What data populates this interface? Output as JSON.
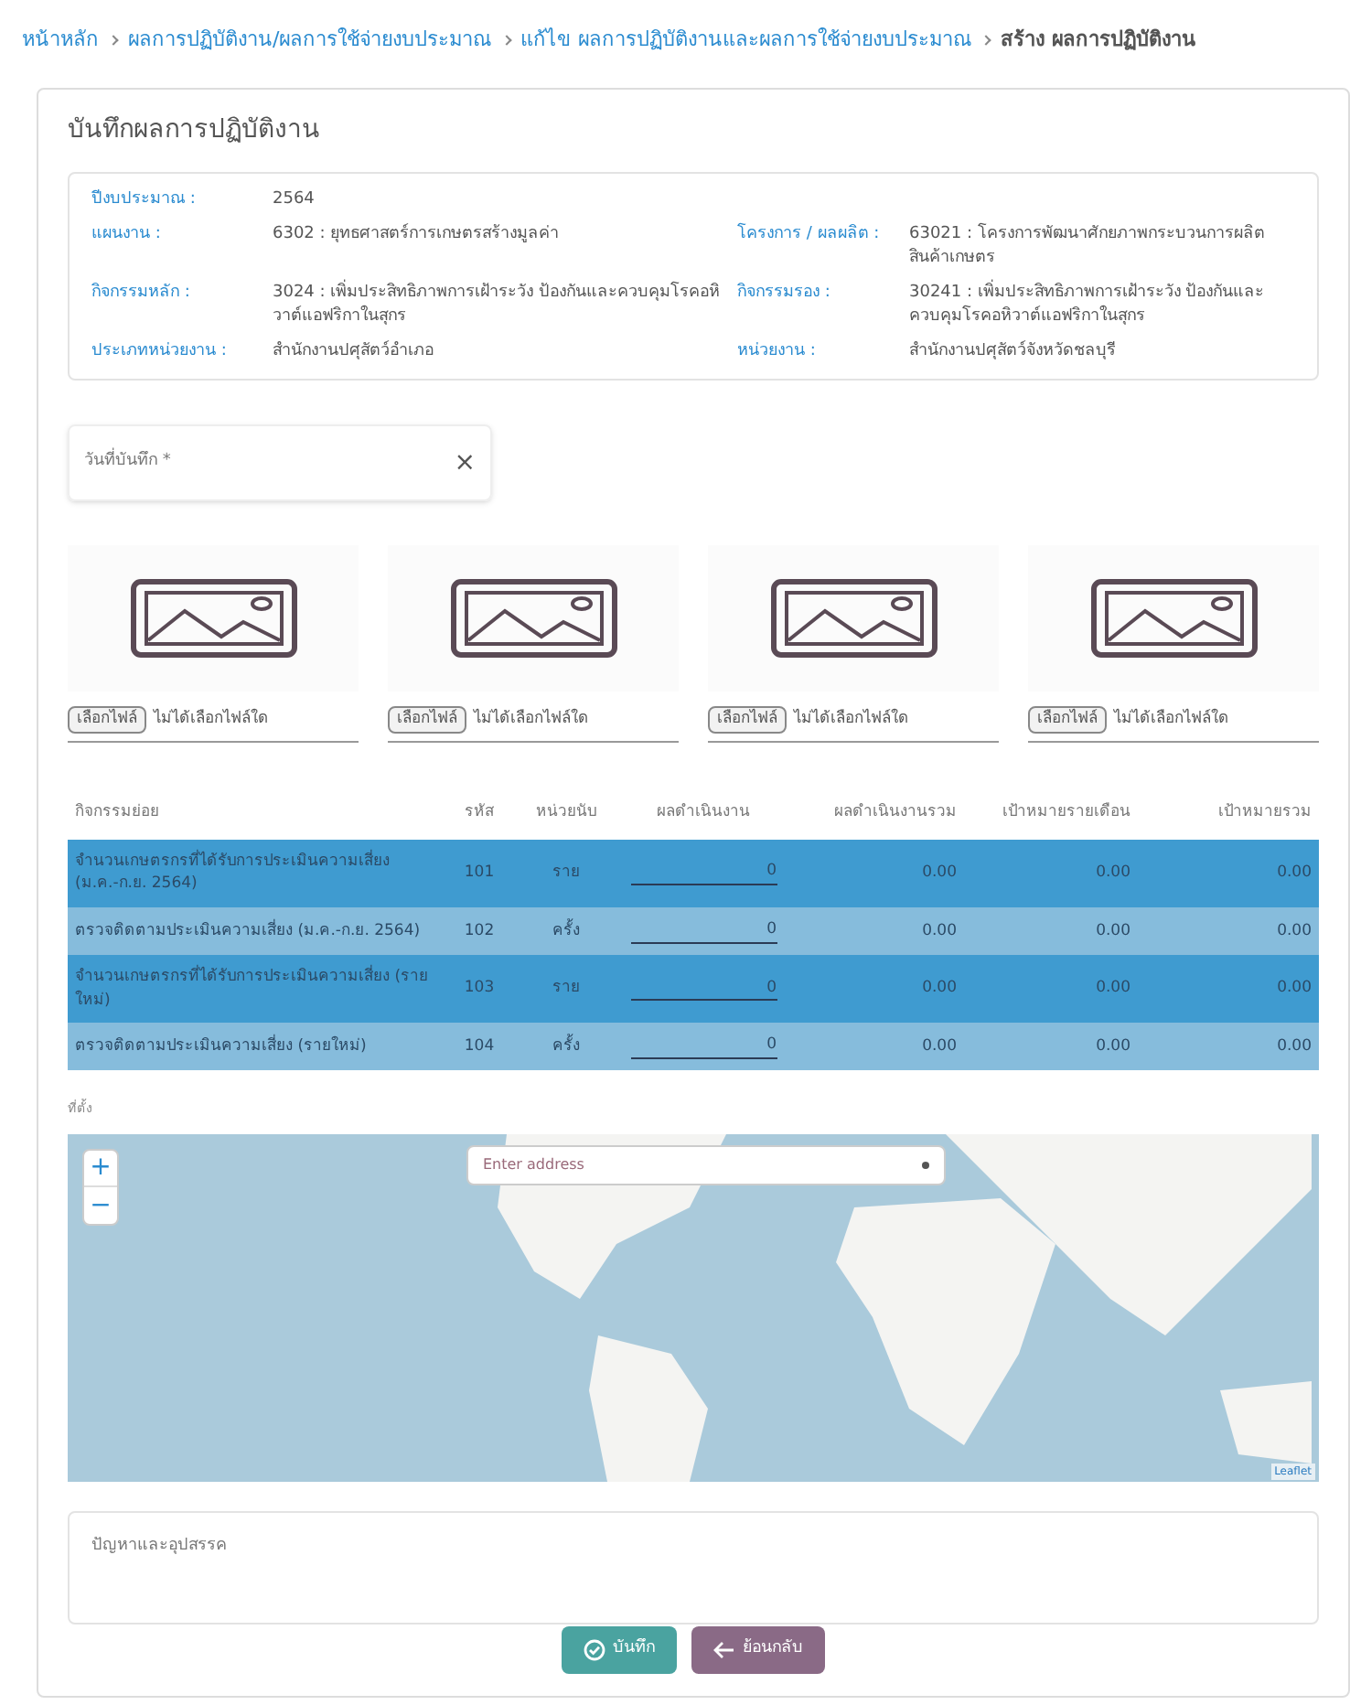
{
  "breadcrumb": [
    {
      "label": "หน้าหลัก",
      "link": true
    },
    {
      "label": "ผลการปฏิบัติงาน/ผลการใช้จ่ายงบประมาณ",
      "link": true
    },
    {
      "label": "แก้ไข ผลการปฏิบัติงานและผลการใช้จ่ายงบประมาณ",
      "link": true
    },
    {
      "label": "สร้าง ผลการปฏิบัติงาน",
      "link": false
    }
  ],
  "card_title": "บันทึกผลการปฏิบัติงาน",
  "info": [
    {
      "label": "ปีงบประมาณ :",
      "value": "2564"
    },
    {
      "label": "แผนงาน :",
      "value": "6302 : ยุทธศาสตร์การเกษตรสร้างมูลค่า"
    },
    {
      "label": "โครงการ / ผลผลิต :",
      "value": "63021 : โครงการพัฒนาศักยภาพกระบวนการผลิตสินค้าเกษตร"
    },
    {
      "label": "กิจกรรมหลัก :",
      "value": "3024 : เพิ่มประสิทธิภาพการเฝ้าระวัง ป้องกันและควบคุมโรคอหิวาต์แอฟริกาในสุกร"
    },
    {
      "label": "กิจกรรมรอง :",
      "value": "30241 : เพิ่มประสิทธิภาพการเฝ้าระวัง ป้องกันและควบคุมโรคอหิวาต์แอฟริกาในสุกร"
    },
    {
      "label": "ประเภทหน่วยงาน :",
      "value": "สำนักงานปศุสัตว์อำเภอ"
    },
    {
      "label": "หน่วยงาน :",
      "value": "สำนักงานปศุสัตว์จังหวัดชลบุรี"
    }
  ],
  "date_field": {
    "placeholder": "วันที่บันทึก *",
    "clear": "×"
  },
  "uploads": [
    {
      "button": "เลือกไฟล์",
      "status": "ไม่ได้เลือกไฟล์ใด"
    },
    {
      "button": "เลือกไฟล์",
      "status": "ไม่ได้เลือกไฟล์ใด"
    },
    {
      "button": "เลือกไฟล์",
      "status": "ไม่ได้เลือกไฟล์ใด"
    },
    {
      "button": "เลือกไฟล์",
      "status": "ไม่ได้เลือกไฟล์ใด"
    }
  ],
  "table": {
    "columns": [
      "กิจกรรมย่อย",
      "รหัส",
      "หน่วยนับ",
      "ผลดำเนินงาน",
      "ผลดำเนินงานรวม",
      "เป้าหมายรายเดือน",
      "เป้าหมายรวม"
    ],
    "rows": [
      {
        "activity": "จำนวนเกษตรกรที่ได้รับการประเมินความเสี่ยง (ม.ค.-ก.ย. 2564)",
        "code": "101",
        "unit": "ราย",
        "result": "0",
        "total": "0.00",
        "monthly_target": "0.00",
        "target": "0.00"
      },
      {
        "activity": "ตรวจติดตามประเมินความเสี่ยง (ม.ค.-ก.ย. 2564)",
        "code": "102",
        "unit": "ครั้ง",
        "result": "0",
        "total": "0.00",
        "monthly_target": "0.00",
        "target": "0.00"
      },
      {
        "activity": "จำนวนเกษตรกรที่ได้รับการประเมินความเสี่ยง (รายใหม่)",
        "code": "103",
        "unit": "ราย",
        "result": "0",
        "total": "0.00",
        "monthly_target": "0.00",
        "target": "0.00"
      },
      {
        "activity": "ตรวจติดตามประเมินความเสี่ยง (รายใหม่)",
        "code": "104",
        "unit": "ครั้ง",
        "result": "0",
        "total": "0.00",
        "monthly_target": "0.00",
        "target": "0.00"
      }
    ]
  },
  "map": {
    "label": "ที่ตั้ง",
    "search_placeholder": "Enter address",
    "zoom_in": "+",
    "zoom_out": "−",
    "attribution": "Leaflet"
  },
  "problems_field": {
    "placeholder": "ปัญหาและอุปสรรค"
  },
  "buttons": [
    {
      "label": "บันทึก",
      "kind": "save"
    },
    {
      "label": "ย้อนกลับ",
      "kind": "back"
    }
  ]
}
